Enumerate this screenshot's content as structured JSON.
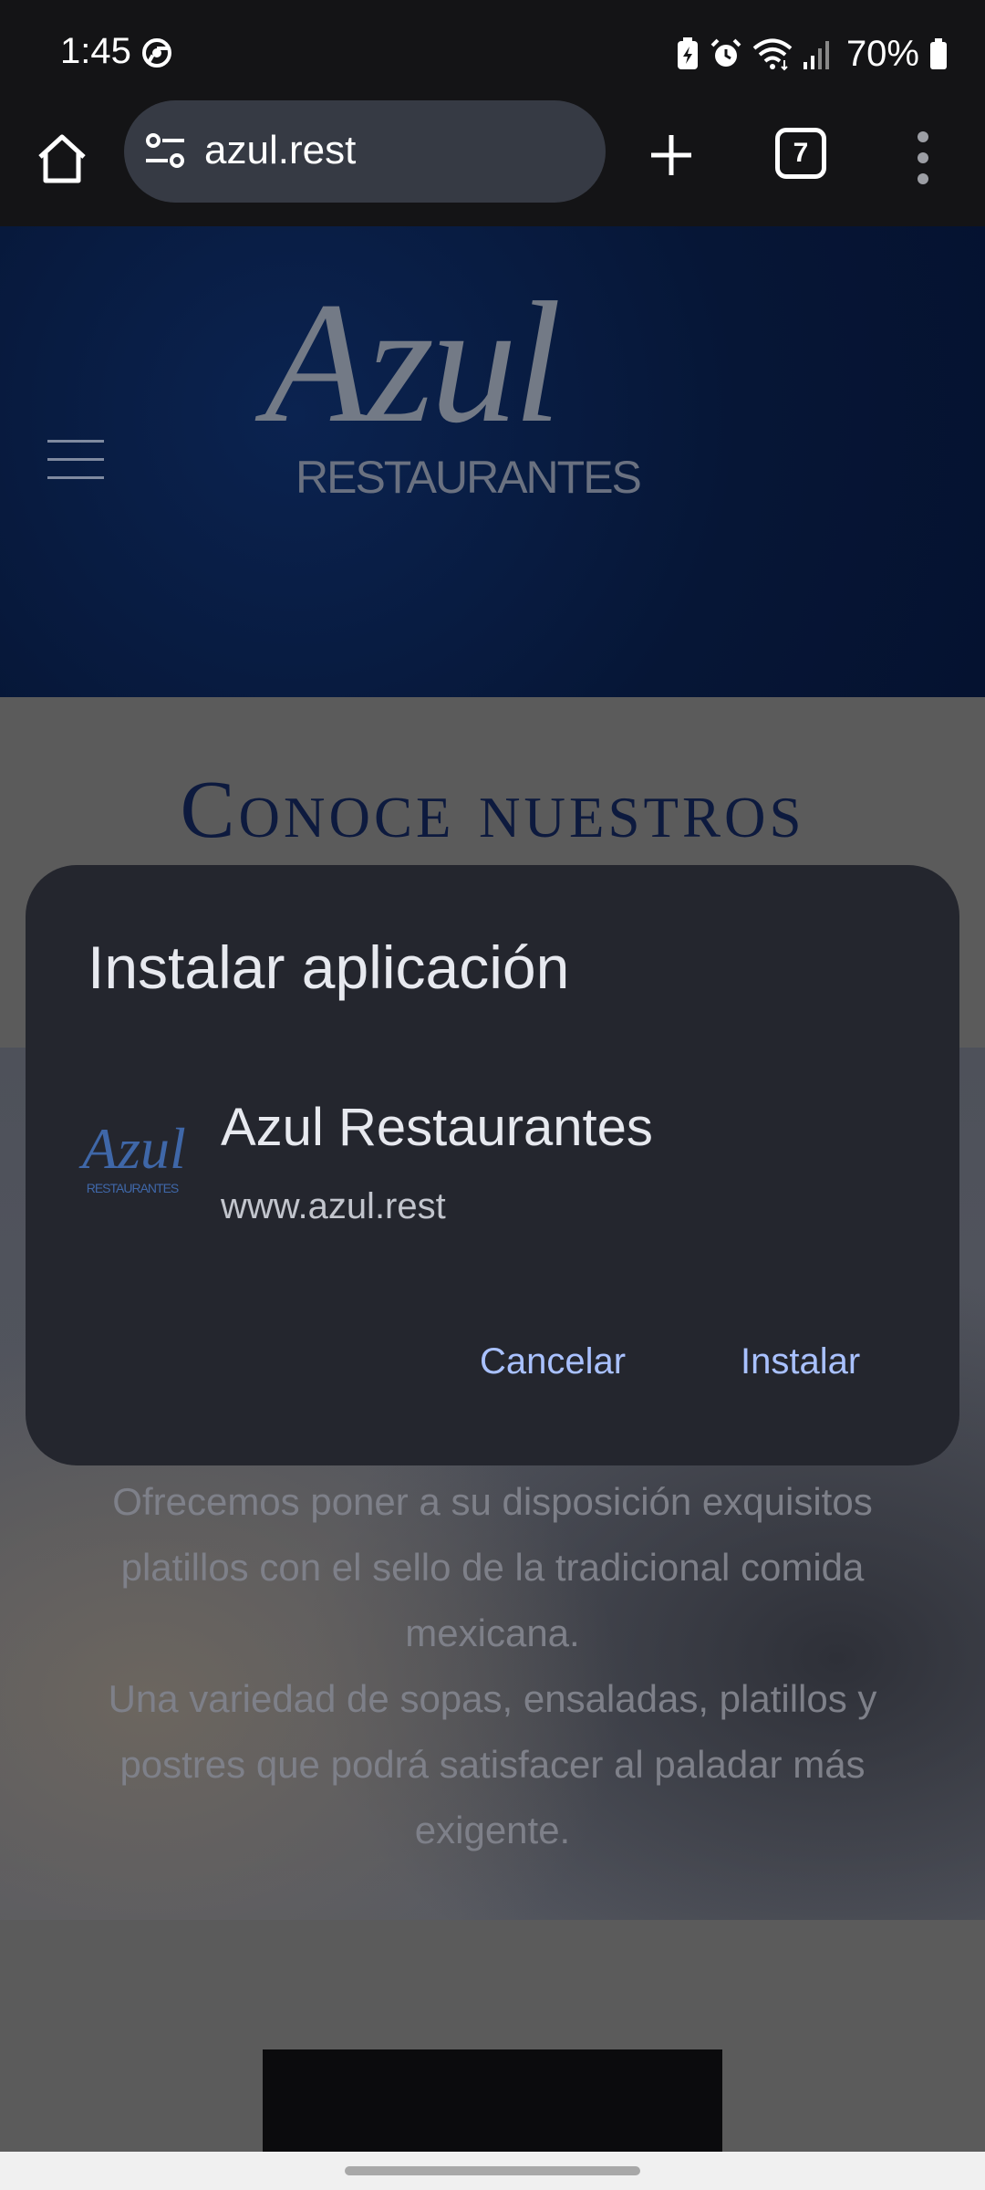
{
  "status_bar": {
    "time": "1:45",
    "battery": "70%",
    "icons": [
      "chrome-icon",
      "battery-saver-icon",
      "alarm-icon",
      "wifi-icon",
      "signal-icon",
      "battery-icon"
    ]
  },
  "browser": {
    "url": "azul.rest",
    "tab_count": "7",
    "icons": [
      "home-icon",
      "tune-icon",
      "plus-icon",
      "tabs-icon",
      "more-vert-icon"
    ]
  },
  "site": {
    "logo_script": "Azul",
    "logo_sub": "RESTAURANTES",
    "section_title": "Conoce nuestros",
    "hero_lines": [
      "Ofrecemos poner a su disposición exquisitos",
      "platillos con el sello de la tradicional comida",
      "mexicana.",
      "Una variedad de sopas, ensaladas, platillos y",
      "postres que podrá satisfacer al paladar más",
      "exigente."
    ]
  },
  "dialog": {
    "title": "Instalar aplicación",
    "app_name": "Azul Restaurantes",
    "app_url": "www.azul.rest",
    "icon_script": "Azul",
    "icon_sub": "RESTAURANTES",
    "cancel_label": "Cancelar",
    "install_label": "Instalar"
  },
  "colors": {
    "dialog_bg": "#24262e",
    "accent": "#a9c1ff",
    "header_bg": "#071a3e"
  }
}
